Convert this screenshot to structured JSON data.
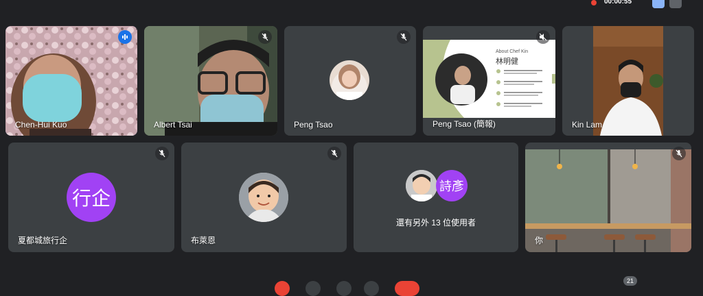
{
  "topbar": {
    "timer": "00:00:55"
  },
  "row1": [
    {
      "name": "Chen-Hui Kuo"
    },
    {
      "name": "Albert Tsai"
    },
    {
      "name": "Peng Tsao"
    },
    {
      "name": "Peng Tsao (簡報)"
    },
    {
      "name": "Kin Lam"
    }
  ],
  "slide": {
    "about": "About Chef Kin",
    "title": "林明健"
  },
  "row2": [
    {
      "name": "夏都城旅行企",
      "avatar_text": "行企"
    },
    {
      "name": "布萊恩"
    },
    {
      "avatar_text": "詩彥",
      "others": "還有另外 13 位使用者"
    },
    {
      "name": "你"
    }
  ],
  "bottom": {
    "participants_badge": "21"
  },
  "colors": {
    "accent": "#8ab4f8",
    "avatar": "#a142f4",
    "tile": "#3c4043",
    "bg": "#202124"
  }
}
